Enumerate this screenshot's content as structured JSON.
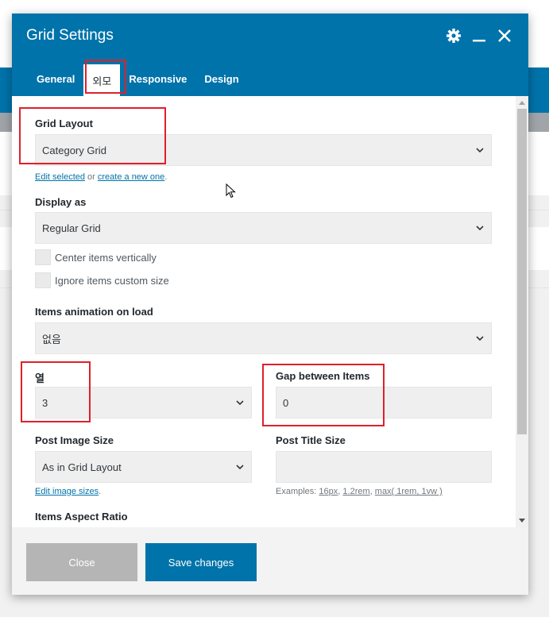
{
  "modal": {
    "title": "Grid Settings",
    "tabs": [
      {
        "label": "General",
        "active": false
      },
      {
        "label": "외모",
        "active": true
      },
      {
        "label": "Responsive",
        "active": false
      },
      {
        "label": "Design",
        "active": false
      }
    ]
  },
  "fields": {
    "grid_layout": {
      "label": "Grid Layout",
      "value": "Category Grid",
      "edit_link": "Edit selected",
      "or_text": "or",
      "create_link": "create a new one",
      "trailing": "."
    },
    "display_as": {
      "label": "Display as",
      "value": "Regular Grid"
    },
    "center_items": {
      "label": "Center items vertically",
      "checked": false
    },
    "ignore_size": {
      "label": "Ignore items custom size",
      "checked": false
    },
    "animation": {
      "label": "Items animation on load",
      "value": "없음"
    },
    "columns": {
      "label": "열",
      "value": "3"
    },
    "gap": {
      "label": "Gap between Items",
      "value": "0"
    },
    "post_image_size": {
      "label": "Post Image Size",
      "value": "As in Grid Layout",
      "edit_link": "Edit image sizes",
      "trailing": "."
    },
    "post_title_size": {
      "label": "Post Title Size",
      "value": "",
      "examples_prefix": "Examples:",
      "ex1": "16px",
      "ex2": "1.2rem",
      "ex3": "max( 1rem, 1vw )"
    },
    "aspect_ratio": {
      "label": "Items Aspect Ratio"
    }
  },
  "footer": {
    "close_label": "Close",
    "save_label": "Save changes"
  },
  "colors": {
    "accent": "#0073aa",
    "highlight": "#e0202a"
  },
  "icons": [
    "gear-icon",
    "minimize-icon",
    "close-icon",
    "chevron-down-icon",
    "mouse-cursor-icon"
  ]
}
